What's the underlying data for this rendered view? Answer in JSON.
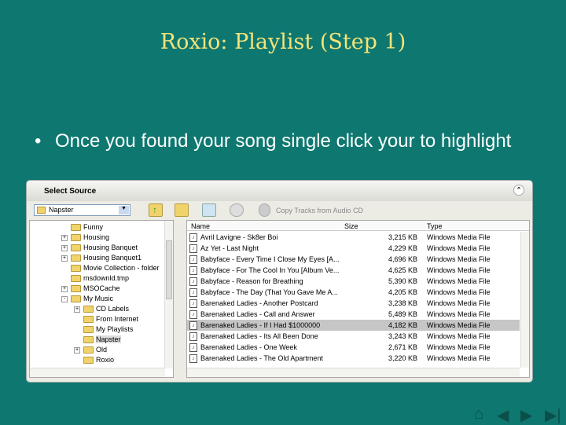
{
  "slide": {
    "title": "Roxio: Playlist (Step 1)",
    "bullet": "Once you found your song single click your to highlight"
  },
  "window": {
    "header": "Select Source",
    "combo_value": "Napster",
    "copy_label": "Copy Tracks from Audio CD"
  },
  "tree": [
    {
      "label": "Funny",
      "level": 0,
      "pm": ""
    },
    {
      "label": "Housing",
      "level": 0,
      "pm": "+"
    },
    {
      "label": "Housing Banquet",
      "level": 0,
      "pm": "+"
    },
    {
      "label": "Housing Banquet1",
      "level": 0,
      "pm": "+"
    },
    {
      "label": "Movie Collection - folder",
      "level": 0,
      "pm": ""
    },
    {
      "label": "msdownld.tmp",
      "level": 0,
      "pm": ""
    },
    {
      "label": "MSOCache",
      "level": 0,
      "pm": "+"
    },
    {
      "label": "My Music",
      "level": 0,
      "pm": "-"
    },
    {
      "label": "CD Labels",
      "level": 1,
      "pm": "+"
    },
    {
      "label": "From Internet",
      "level": 1,
      "pm": ""
    },
    {
      "label": "My Playlists",
      "level": 1,
      "pm": ""
    },
    {
      "label": "Napster",
      "level": 1,
      "pm": "",
      "selected": true
    },
    {
      "label": "Old",
      "level": 1,
      "pm": "+"
    },
    {
      "label": "Roxio",
      "level": 1,
      "pm": ""
    }
  ],
  "list": {
    "columns": [
      "Name",
      "Size",
      "Type"
    ],
    "rows": [
      {
        "name": "Avril Lavigne - Sk8er Boi",
        "size": "3,215 KB",
        "type": "Windows Media File"
      },
      {
        "name": "Az Yet - Last Night",
        "size": "4,229 KB",
        "type": "Windows Media File"
      },
      {
        "name": "Babyface - Every Time I Close My Eyes [A...",
        "size": "4,696 KB",
        "type": "Windows Media File"
      },
      {
        "name": "Babyface - For The Cool In You [Album Ve...",
        "size": "4,625 KB",
        "type": "Windows Media File"
      },
      {
        "name": "Babyface - Reason for Breathing",
        "size": "5,390 KB",
        "type": "Windows Media File"
      },
      {
        "name": "Babyface - The Day (That You Gave Me A...",
        "size": "4,205 KB",
        "type": "Windows Media File"
      },
      {
        "name": "Barenaked Ladies - Another Postcard",
        "size": "3,238 KB",
        "type": "Windows Media File"
      },
      {
        "name": "Barenaked Ladies - Call and Answer",
        "size": "5,489 KB",
        "type": "Windows Media File"
      },
      {
        "name": "Barenaked Ladies - If I Had $1000000",
        "size": "4,182 KB",
        "type": "Windows Media File",
        "selected": true
      },
      {
        "name": "Barenaked Ladies - Its All Been Done",
        "size": "3,243 KB",
        "type": "Windows Media File"
      },
      {
        "name": "Barenaked Ladies - One Week",
        "size": "2,671 KB",
        "type": "Windows Media File"
      },
      {
        "name": "Barenaked Ladies - The Old Apartment",
        "size": "3,220 KB",
        "type": "Windows Media File"
      }
    ]
  }
}
